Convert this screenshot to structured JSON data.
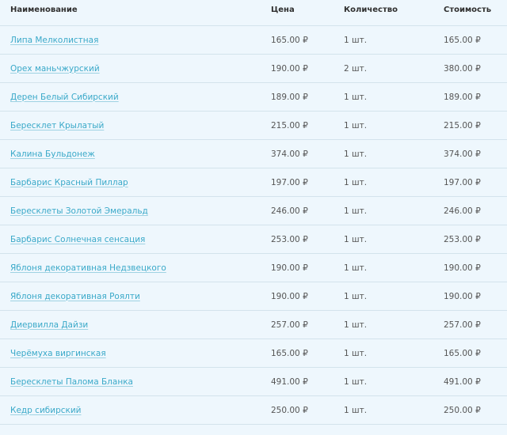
{
  "table": {
    "headers": {
      "name": "Наименование",
      "price": "Цена",
      "qty": "Количество",
      "total": "Стоимость"
    },
    "rows": [
      {
        "name": "Липа Мелколистная",
        "price": "165.00 ₽",
        "qty": "1 шт.",
        "total": "165.00 ₽"
      },
      {
        "name": "Орех маньчжурский",
        "price": "190.00 ₽",
        "qty": "2 шт.",
        "total": "380.00 ₽"
      },
      {
        "name": "Дерен Белый Сибирский",
        "price": "189.00 ₽",
        "qty": "1 шт.",
        "total": "189.00 ₽"
      },
      {
        "name": "Бересклет Крылатый",
        "price": "215.00 ₽",
        "qty": "1 шт.",
        "total": "215.00 ₽"
      },
      {
        "name": "Калина Бульдонеж",
        "price": "374.00 ₽",
        "qty": "1 шт.",
        "total": "374.00 ₽"
      },
      {
        "name": "Барбарис Красный Пиллар",
        "price": "197.00 ₽",
        "qty": "1 шт.",
        "total": "197.00 ₽"
      },
      {
        "name": "Бересклеты Золотой Эмеральд",
        "price": "246.00 ₽",
        "qty": "1 шт.",
        "total": "246.00 ₽"
      },
      {
        "name": "Барбарис Солнечная сенсация",
        "price": "253.00 ₽",
        "qty": "1 шт.",
        "total": "253.00 ₽"
      },
      {
        "name": "Яблоня декоративная Недзвецкого",
        "price": "190.00 ₽",
        "qty": "1 шт.",
        "total": "190.00 ₽"
      },
      {
        "name": "Яблоня декоративная Роялти",
        "price": "190.00 ₽",
        "qty": "1 шт.",
        "total": "190.00 ₽"
      },
      {
        "name": "Диервилла Дайзи",
        "price": "257.00 ₽",
        "qty": "1 шт.",
        "total": "257.00 ₽"
      },
      {
        "name": "Черёмуха виргинская",
        "price": "165.00 ₽",
        "qty": "1 шт.",
        "total": "165.00 ₽"
      },
      {
        "name": "Бересклеты Палома Бланка",
        "price": "491.00 ₽",
        "qty": "1 шт.",
        "total": "491.00 ₽"
      },
      {
        "name": "Кедр сибирский",
        "price": "250.00 ₽",
        "qty": "1 шт.",
        "total": "250.00 ₽"
      }
    ]
  },
  "colors": {
    "background": "#eef7fd",
    "link": "#3aa9c9",
    "divider": "#d3e3ec"
  }
}
